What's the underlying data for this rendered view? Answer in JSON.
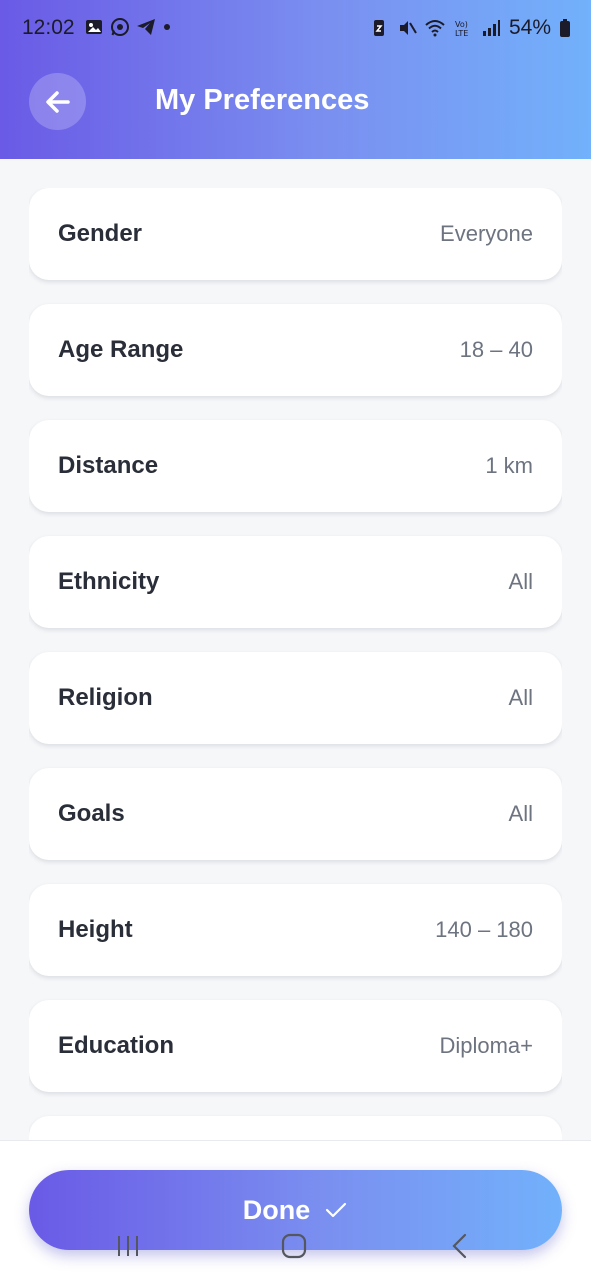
{
  "statusbar": {
    "time": "12:02",
    "battery": "54%",
    "left_icons": [
      "gallery-icon",
      "whatsapp-icon",
      "telegram-icon",
      "dot-icon"
    ],
    "right_icons": [
      "battery-saver-icon",
      "mute-icon",
      "wifi-icon",
      "volte-icon",
      "signal-icon",
      "battery-icon"
    ]
  },
  "header": {
    "title": "My Preferences",
    "back_icon": "arrow-left-icon"
  },
  "preferences": [
    {
      "label": "Gender",
      "value": "Everyone"
    },
    {
      "label": "Age Range",
      "value": "18 – 40"
    },
    {
      "label": "Distance",
      "value": "1 km"
    },
    {
      "label": "Ethnicity",
      "value": "All"
    },
    {
      "label": "Religion",
      "value": "All"
    },
    {
      "label": "Goals",
      "value": "All"
    },
    {
      "label": "Height",
      "value": "140 – 180"
    },
    {
      "label": "Education",
      "value": "Diploma+"
    },
    {
      "label": "",
      "value": ""
    }
  ],
  "footer": {
    "done_label": "Done",
    "done_icon": "check-icon"
  },
  "colors": {
    "gradient_start": "#6a5ae6",
    "gradient_end": "#72b1fb",
    "background": "#f6f7f9",
    "card": "#ffffff",
    "label_text": "#2a2e38",
    "value_text": "#6d7480"
  }
}
